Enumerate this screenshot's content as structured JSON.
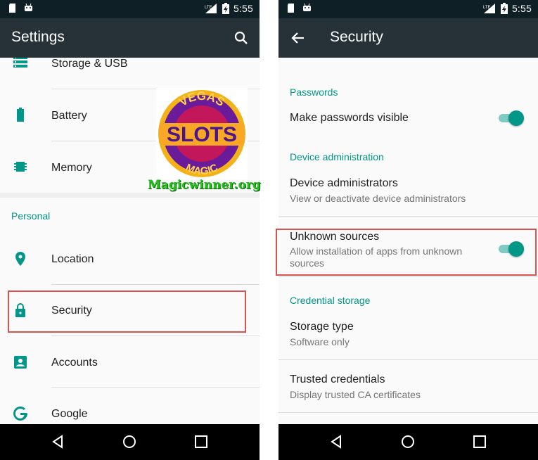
{
  "status": {
    "network": "LTE",
    "time": "5:55"
  },
  "left": {
    "title": "Settings",
    "items": [
      {
        "label": "Storage & USB",
        "icon": "storage-icon"
      },
      {
        "label": "Battery",
        "icon": "battery-icon"
      },
      {
        "label": "Memory",
        "icon": "memory-icon"
      },
      {
        "label": "Location",
        "icon": "location-icon"
      },
      {
        "label": "Security",
        "icon": "lock-icon"
      },
      {
        "label": "Accounts",
        "icon": "account-icon"
      },
      {
        "label": "Google",
        "icon": "google-icon"
      }
    ],
    "section_personal": "Personal"
  },
  "right": {
    "title": "Security",
    "passwords_header": "Passwords",
    "make_passwords_visible": "Make passwords visible",
    "device_admin_header": "Device administration",
    "device_admins_title": "Device administrators",
    "device_admins_sub": "View or deactivate device administrators",
    "unknown_sources_title": "Unknown sources",
    "unknown_sources_sub": "Allow installation of apps from unknown sources",
    "credential_header": "Credential storage",
    "storage_type_title": "Storage type",
    "storage_type_sub": "Software only",
    "trusted_title": "Trusted credentials",
    "trusted_sub": "Display trusted CA certificates",
    "toggles": {
      "make_passwords_visible": true,
      "unknown_sources": true
    }
  },
  "watermark": {
    "logo_top": "VEGAS",
    "logo_mid": "SLOTS",
    "logo_bottom": "MAGIC",
    "caption": "Magicwinner.org"
  },
  "colors": {
    "accent": "#009688",
    "appbar": "#263238",
    "statusbar": "#0e1f26",
    "highlight": "#d9534f"
  }
}
